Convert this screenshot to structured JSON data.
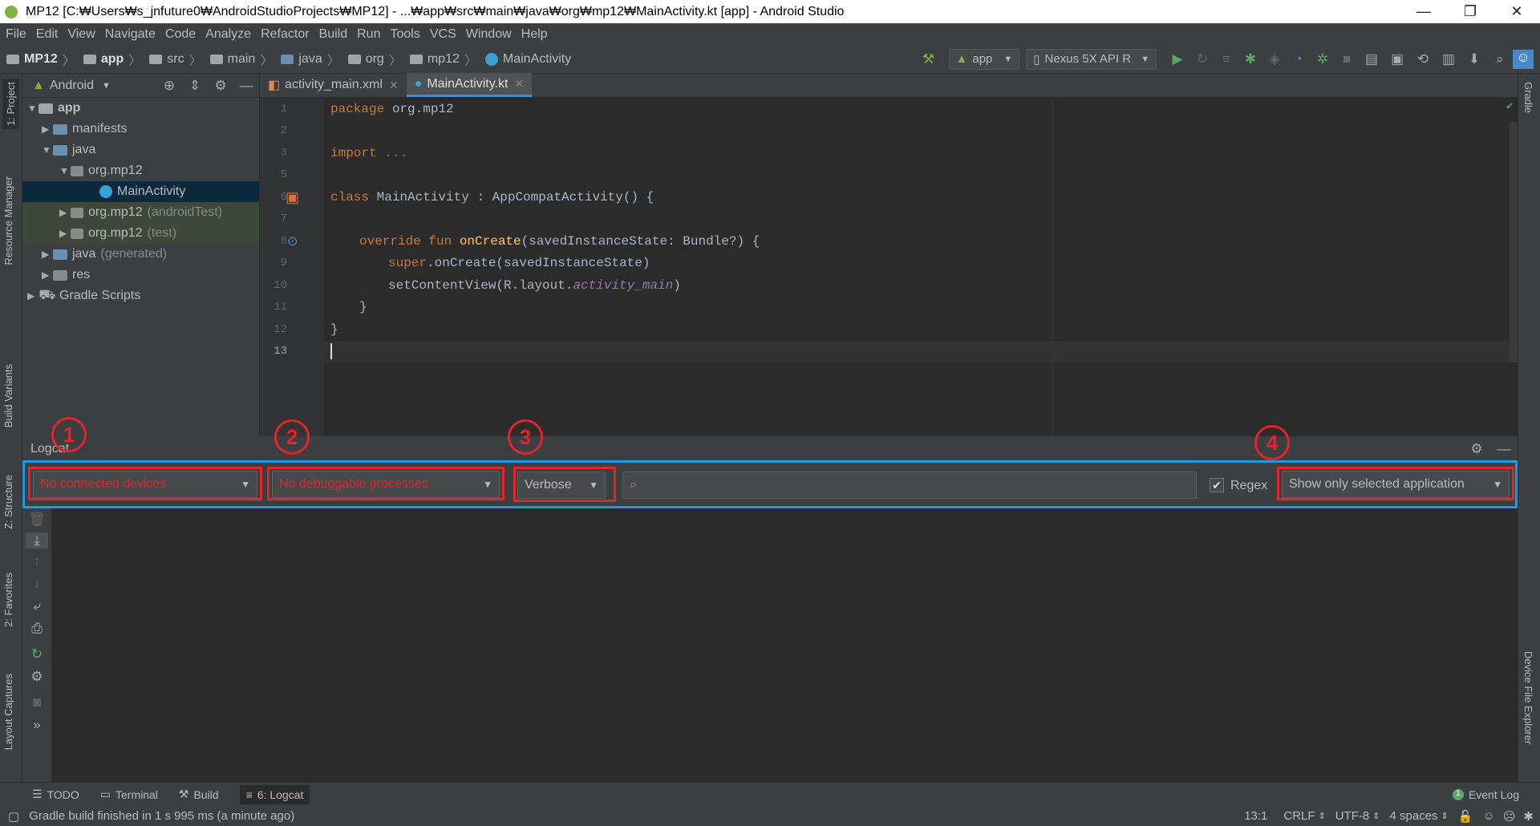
{
  "window": {
    "title": "MP12 [C:₩Users₩s_jnfuture0₩AndroidStudioProjects₩MP12] - ...₩app₩src₩main₩java₩org₩mp12₩MainActivity.kt [app] - Android Studio"
  },
  "menu": [
    "File",
    "Edit",
    "View",
    "Navigate",
    "Code",
    "Analyze",
    "Refactor",
    "Build",
    "Run",
    "Tools",
    "VCS",
    "Window",
    "Help"
  ],
  "breadcrumbs": [
    "MP12",
    "app",
    "src",
    "main",
    "java",
    "org",
    "mp12",
    "MainActivity"
  ],
  "toolbar": {
    "run_config": "app",
    "device": "Nexus 5X API R"
  },
  "project": {
    "view": "Android",
    "tree": [
      {
        "label": "app",
        "extra": ""
      },
      {
        "label": "manifests",
        "extra": ""
      },
      {
        "label": "java",
        "extra": ""
      },
      {
        "label": "org.mp12",
        "extra": ""
      },
      {
        "label": "MainActivity",
        "extra": ""
      },
      {
        "label": "org.mp12",
        "extra": "(androidTest)"
      },
      {
        "label": "org.mp12",
        "extra": "(test)"
      },
      {
        "label": "java",
        "extra": "(generated)"
      },
      {
        "label": "res",
        "extra": ""
      },
      {
        "label": "Gradle Scripts",
        "extra": ""
      }
    ]
  },
  "editor": {
    "tabs": [
      "activity_main.xml",
      "MainActivity.kt"
    ],
    "line_numbers": [
      "1",
      "2",
      "3",
      "5",
      "6",
      "7",
      "8",
      "9",
      "10",
      "11",
      "12",
      "13"
    ],
    "code": {
      "l1_kw": "package",
      "l1_rest": " org.mp12",
      "l3_kw": "import",
      "l3_rest": " ...",
      "l6_kw": "class",
      "l6_rest": " MainActivity : AppCompatActivity() {",
      "l8_kw": "override fun",
      "l8_fn": "onCreate",
      "l8_rest": "(savedInstanceState: Bundle?) {",
      "l9_kw": "super",
      "l9_rest": ".onCreate(savedInstanceState)",
      "l10_rest": "setContentView(R.layout.",
      "l10_prop": "activity_main",
      "l10_end": ")",
      "l11": "}",
      "l12": "}"
    }
  },
  "logcat": {
    "title": "Logcat",
    "device": "No connected devices",
    "process": "No debuggable processes",
    "level": "Verbose",
    "search_placeholder": "",
    "regex_label": "Regex",
    "regex_checked": true,
    "filter": "Show only selected application",
    "annotations": [
      "1",
      "2",
      "3",
      "4"
    ]
  },
  "left_tabs": [
    "1: Project",
    "Resource Manager",
    "Build Variants",
    "Z: Structure",
    "2: Favorites",
    "Layout Captures"
  ],
  "right_tabs": [
    "Gradle",
    "Device File Explorer"
  ],
  "bottom_tabs": [
    "TODO",
    "Terminal",
    "Build",
    "6: Logcat"
  ],
  "event_log": "Event Log",
  "status": {
    "message": "Gradle build finished in 1 s 995 ms (a minute ago)",
    "position": "13:1",
    "line_sep": "CRLF",
    "encoding": "UTF-8",
    "indent": "4 spaces"
  },
  "colors": {
    "annotation_red": "#e3242b",
    "highlight_blue": "#1e9be0",
    "accent_blue": "#4a88c7"
  }
}
